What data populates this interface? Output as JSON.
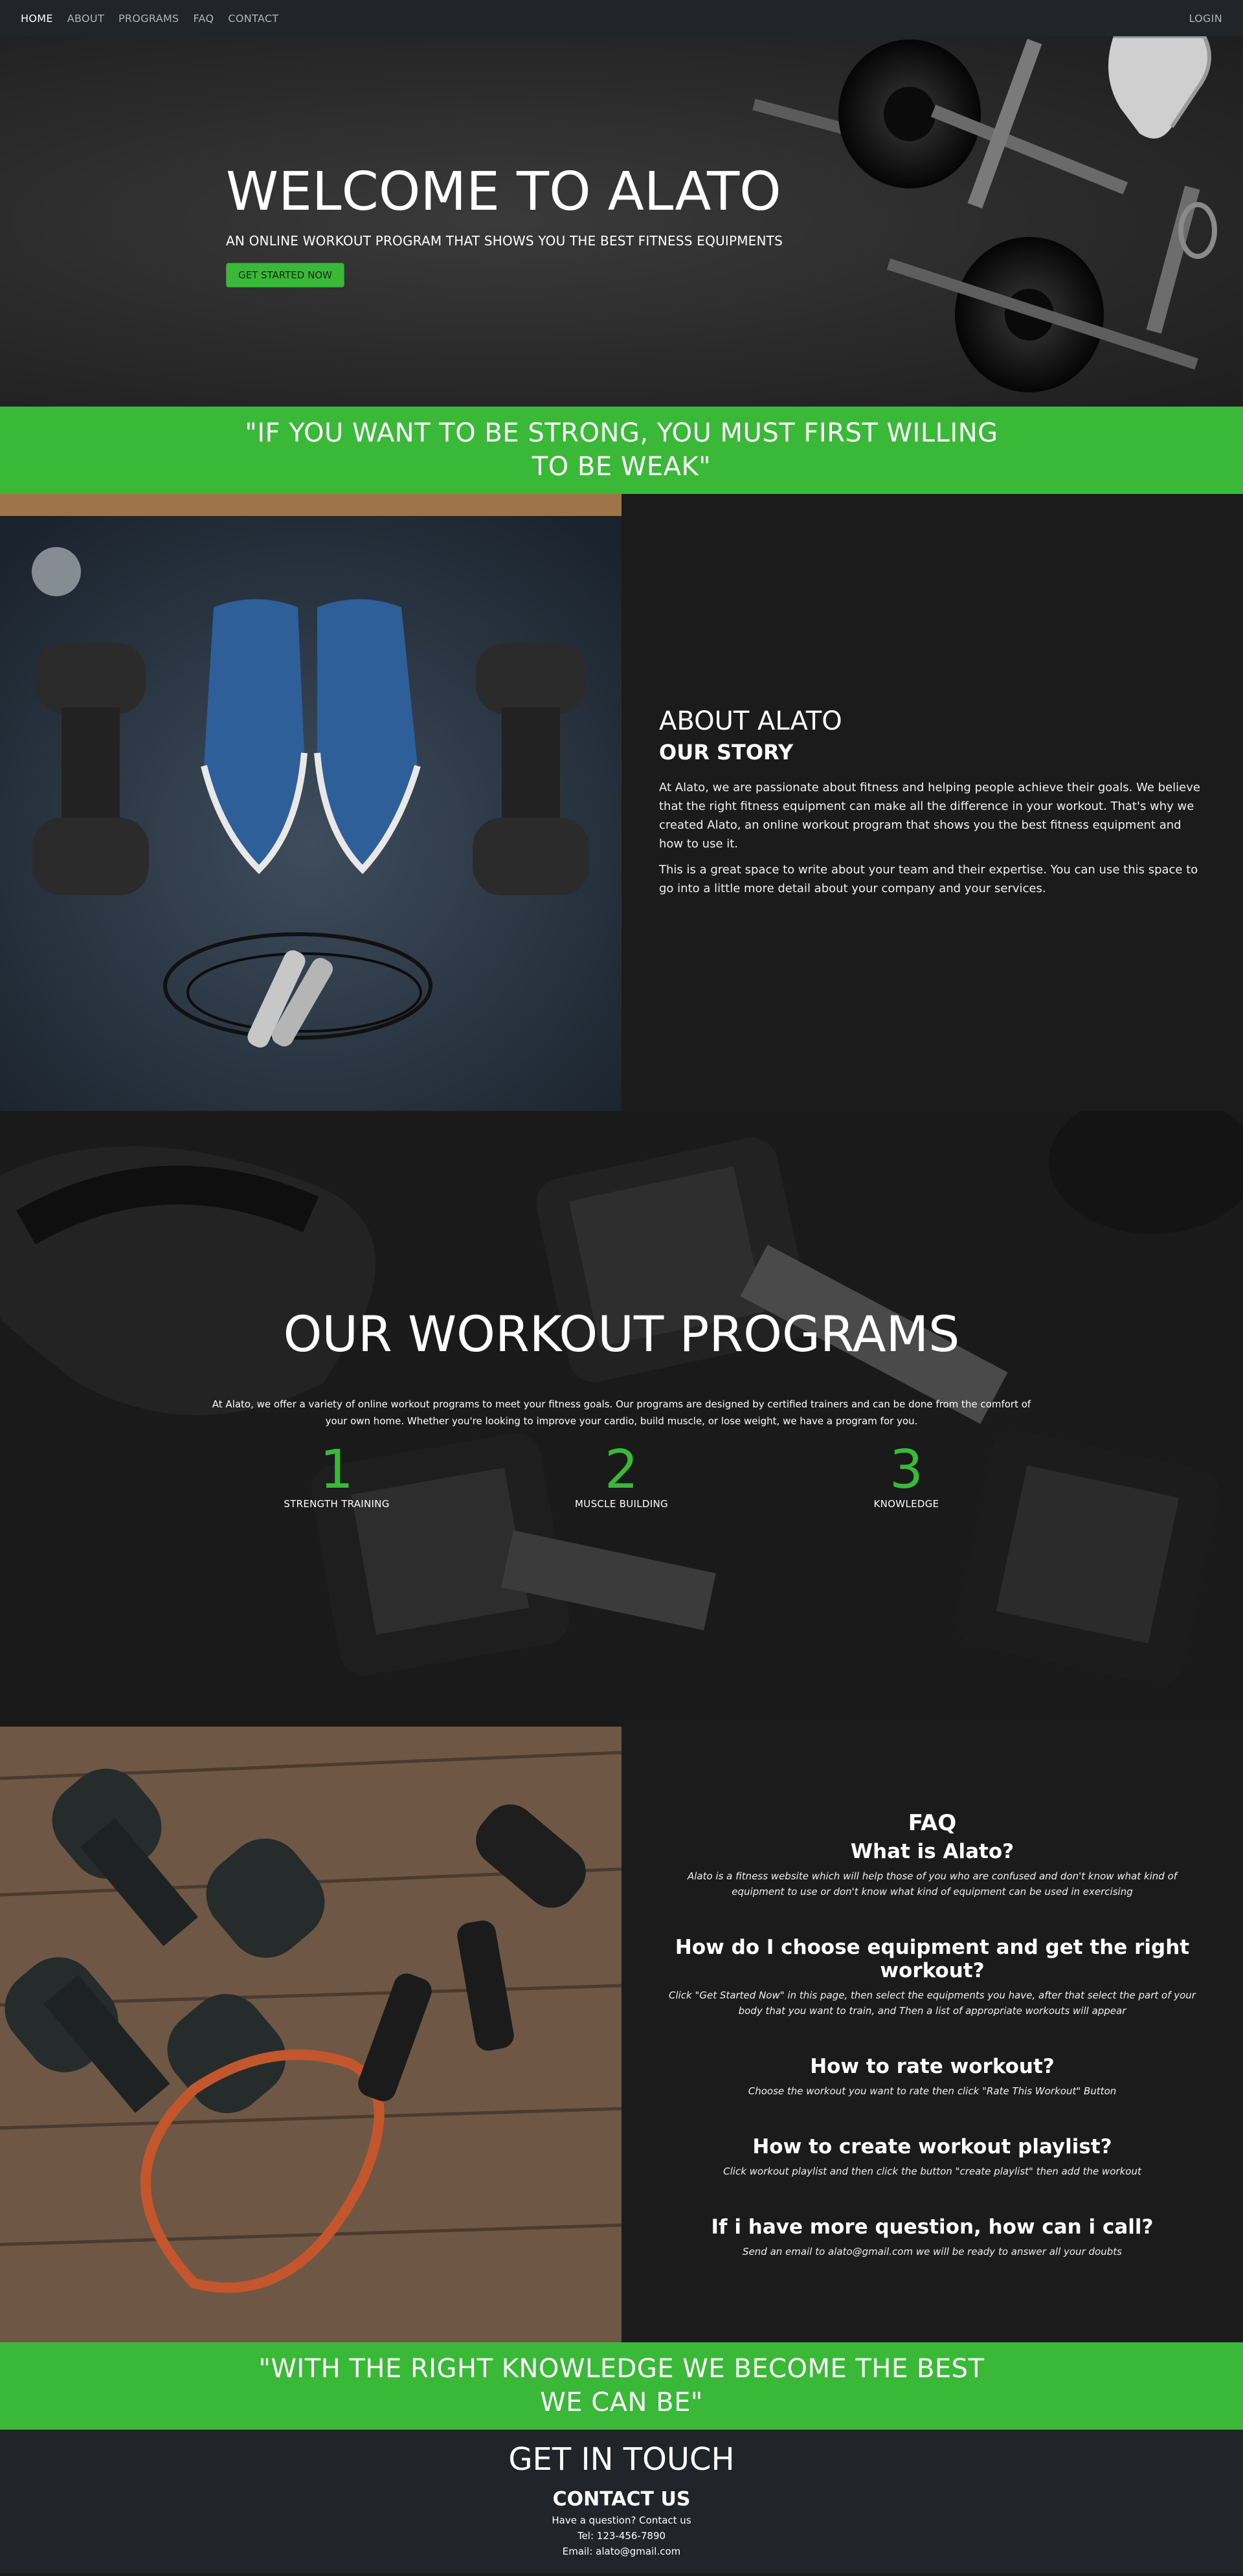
{
  "nav": {
    "links": [
      "HOME",
      "ABOUT",
      "PROGRAMS",
      "FAQ",
      "CONTACT"
    ],
    "login": "LOGIN"
  },
  "hero": {
    "title": "WELCOME TO ALATO",
    "subtitle": "AN ONLINE WORKOUT PROGRAM THAT SHOWS YOU THE BEST FITNESS EQUIPMENTS",
    "button": "GET STARTED NOW"
  },
  "quote1": "\"IF YOU WANT TO BE STRONG, YOU MUST FIRST WILLING TO BE WEAK\"",
  "about": {
    "title": "ABOUT ALATO",
    "subtitle": "OUR STORY",
    "p1": "At Alato, we are passionate about fitness and helping people achieve their goals. We believe that the right fitness equipment can make all the difference in your workout. That's why we created Alato, an online workout program that shows you the best fitness equipment and how to use it.",
    "p2": "This is a great space to write about your team and their expertise. You can use this space to go into a little more detail about your company and your services."
  },
  "programs": {
    "title": "OUR WORKOUT PROGRAMS",
    "text": "At Alato, we offer a variety of online workout programs to meet your fitness goals. Our programs are designed by certified trainers and can be done from the comfort of your own home. Whether you're looking to improve your cardio, build muscle, or lose weight, we have a program for you.",
    "items": [
      {
        "num": "1",
        "label": "STRENGTH TRAINING"
      },
      {
        "num": "2",
        "label": "MUSCLE BUILDING"
      },
      {
        "num": "3",
        "label": "KNOWLEDGE"
      }
    ]
  },
  "faq": {
    "title": "FAQ",
    "items": [
      {
        "q": "What is Alato?",
        "a": "Alato is a fitness website which will help those of you who are confused and don't know what kind of equipment to use or don't know what kind of equipment can be used in exercising"
      },
      {
        "q": "How do I choose equipment and get the right workout?",
        "a": "Click \"Get Started Now\" in this page, then select the equipments you have, after that select the part of your body that you want to train, and Then a list of appropriate workouts will appear"
      },
      {
        "q": "How to rate workout?",
        "a": "Choose the workout you want to rate then click \"Rate This Workout\" Button"
      },
      {
        "q": "How to create workout playlist?",
        "a": "Click workout playlist and then click the button \"create playlist\" then add the workout"
      },
      {
        "q": "If i have more question, how can i call?",
        "a": "Send an email to alato@gmail.com we will be ready to answer all your doubts"
      }
    ]
  },
  "quote2": "\"WITH THE RIGHT KNOWLEDGE WE BECOME THE BEST WE CAN BE\"",
  "footer": {
    "title": "GET IN TOUCH",
    "subtitle": "CONTACT US",
    "line1": "Have a question? Contact us",
    "line2": "Tel: 123-456-7890",
    "line3": "Email: alato@gmail.com"
  },
  "colors": {
    "accent": "#3ab938",
    "nav_bg": "#212529",
    "panel_bg": "#1b1b1b"
  }
}
